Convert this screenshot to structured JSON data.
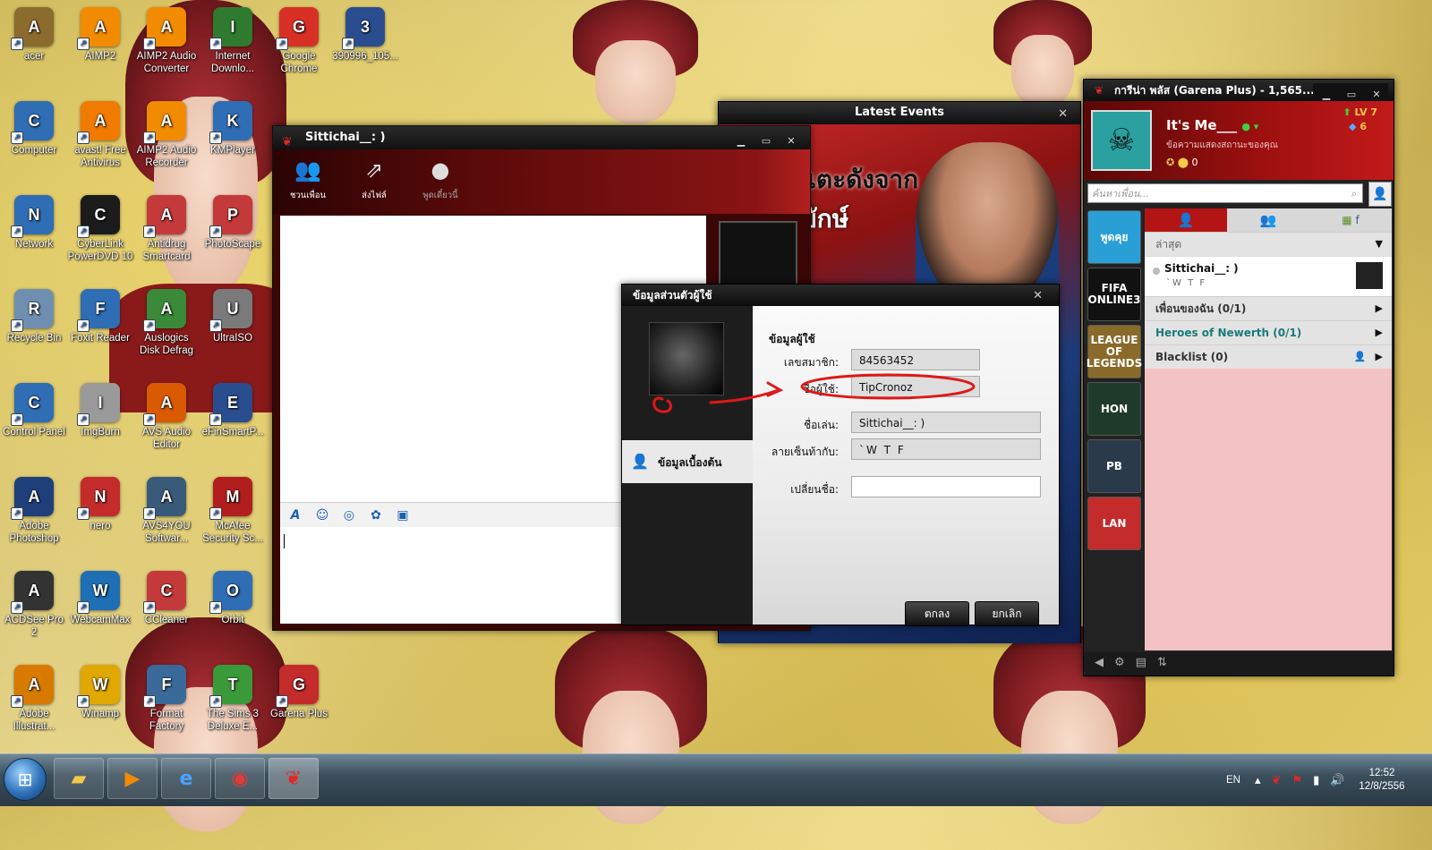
{
  "desktop_icons": [
    {
      "label": "acer",
      "color": "#8c6b2e"
    },
    {
      "label": "AIMP2",
      "color": "#f28b00"
    },
    {
      "label": "AIMP2 Audio Converter",
      "color": "#f28b00"
    },
    {
      "label": "Internet Downlo...",
      "color": "#2f7a2f"
    },
    {
      "label": "Google Chrome",
      "color": "#d93025"
    },
    {
      "label": "390996_105...",
      "color": "#2a4d8f"
    },
    {
      "label": "Computer",
      "color": "#2f6db5"
    },
    {
      "label": "avast! Free Antivirus",
      "color": "#f07b00"
    },
    {
      "label": "AIMP2 Audio Recorder",
      "color": "#f28b00"
    },
    {
      "label": "KMPlayer",
      "color": "#2f6db5"
    },
    {
      "label": "Network",
      "color": "#2f6db5"
    },
    {
      "label": "CyberLink PowerDVD 10",
      "color": "#1b1b1b"
    },
    {
      "label": "Antidrug Smartcard",
      "color": "#c43a3a"
    },
    {
      "label": "PhotoScape",
      "color": "#c43a3a"
    },
    {
      "label": "Recycle Bin",
      "color": "#6e8fb0"
    },
    {
      "label": "Foxit Reader",
      "color": "#2f6db5"
    },
    {
      "label": "Auslogics Disk Defrag",
      "color": "#3a8a3a"
    },
    {
      "label": "UltraISO",
      "color": "#7a7a7a"
    },
    {
      "label": "Control Panel",
      "color": "#2f6db5"
    },
    {
      "label": "ImgBurn",
      "color": "#9a9a9a"
    },
    {
      "label": "AVS Audio Editor",
      "color": "#d95a00"
    },
    {
      "label": "eFinSmartP...",
      "color": "#2a4d8f"
    },
    {
      "label": "Adobe Photoshop",
      "color": "#1f3f7a"
    },
    {
      "label": "nero",
      "color": "#c42b2b"
    },
    {
      "label": "AVS4YOU Softwar...",
      "color": "#3a5a7a"
    },
    {
      "label": "McAfee Security Sc...",
      "color": "#b21e1e"
    },
    {
      "label": "ACDSee Pro 2",
      "color": "#333333"
    },
    {
      "label": "WebcamMax",
      "color": "#1f6fb5"
    },
    {
      "label": "CCleaner",
      "color": "#c43a3a"
    },
    {
      "label": "Orbit",
      "color": "#2f6db5"
    },
    {
      "label": "Adobe Illustrat...",
      "color": "#d87a00"
    },
    {
      "label": "Winamp",
      "color": "#e0a800"
    },
    {
      "label": "Format Factory",
      "color": "#3a6a9a"
    },
    {
      "label": "The Sims 3 Deluxe E...",
      "color": "#3a9a3a"
    },
    {
      "label": "Garena Plus",
      "color": "#c42b2b"
    }
  ],
  "chat_window": {
    "title": "Sittichai__: )",
    "tools": [
      {
        "label": "ชวนเพื่อน",
        "icon": "add-friend-icon"
      },
      {
        "label": "ส่งไฟล์",
        "icon": "send-file-icon"
      },
      {
        "label": "พูดเดี๋ยวนี้",
        "icon": "voice-chat-icon"
      }
    ],
    "format_tools": [
      "A",
      "☺",
      "◎",
      "✿",
      "▣"
    ],
    "message_input": ""
  },
  "events_window": {
    "title": "Latest Events",
    "banner_lines": [
      "ร์ดนักเตะดังจาก",
      "2 ลีกยักษ์"
    ]
  },
  "user_info_dialog": {
    "title": "ข้อมูลส่วนตัวผู้ใช้",
    "nav_item": "ข้อมูลเบื้องต้น",
    "section_title": "ข้อมูลผู้ใช้",
    "fields": {
      "member_id": {
        "label": "เลขสมาชิก:",
        "value": "84563452"
      },
      "username": {
        "label": "ชื่อผู้ใช้:",
        "value": "TipCronoz"
      },
      "nickname": {
        "label": "ชื่อเล่น:",
        "value": "Sittichai__: )"
      },
      "signature": {
        "label": "ลายเซ็นท้ากับ:",
        "value": "`W T F"
      },
      "rename": {
        "label": "เปลี่ยนชื่อ:",
        "value": ""
      }
    },
    "ok_label": "ตกลง",
    "cancel_label": "ยกเลิก"
  },
  "garena_main": {
    "title": "การีน่า พลัส (Garena Plus) - 1,565...",
    "profile": {
      "name": "It's Me___",
      "status": "ข้อความแสดงสถานะของคุณ",
      "level": "LV 7",
      "diamonds": "6",
      "coins": "0"
    },
    "search_placeholder": "ค้นหาเพื่อน...",
    "games": [
      {
        "label": "พูดคุย",
        "color": "#2a9fd6"
      },
      {
        "label": "FIFA ONLINE3",
        "color": "#111111"
      },
      {
        "label": "LEAGUE OF LEGENDS",
        "color": "#8a6a2a"
      },
      {
        "label": "HON",
        "color": "#1f3a2a"
      },
      {
        "label": "PB",
        "color": "#2a3a4a"
      },
      {
        "label": "LAN",
        "color": "#c42b2b"
      }
    ],
    "recent_label": "ล่าสุด",
    "recent_friend": {
      "name": "Sittichai__: )",
      "sub": "`W T F"
    },
    "groups": [
      {
        "label": "เพื่อนของฉัน (0/1)"
      },
      {
        "label": "Heroes of Newerth (0/1)"
      },
      {
        "label": "Blacklist (0)"
      }
    ]
  },
  "taskbar": {
    "language": "EN",
    "time": "12:52",
    "date": "12/8/2556"
  },
  "colors": {
    "garena_red": "#c21a1a",
    "annotation_red": "#e01818"
  }
}
